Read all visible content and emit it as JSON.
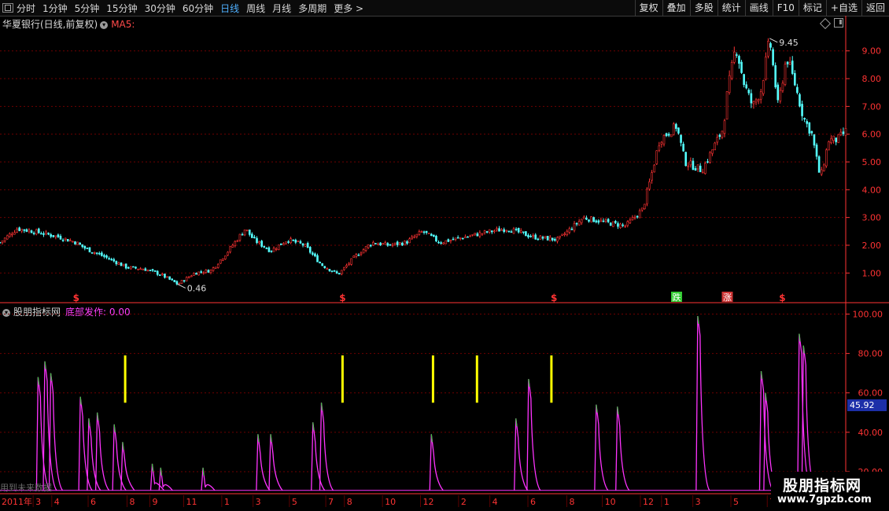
{
  "toolbar": {
    "periods": [
      {
        "label": "分时",
        "active": false
      },
      {
        "label": "1分钟",
        "active": false
      },
      {
        "label": "5分钟",
        "active": false
      },
      {
        "label": "15分钟",
        "active": false
      },
      {
        "label": "30分钟",
        "active": false
      },
      {
        "label": "60分钟",
        "active": false
      },
      {
        "label": "日线",
        "active": true
      },
      {
        "label": "周线",
        "active": false
      },
      {
        "label": "月线",
        "active": false
      },
      {
        "label": "多周期",
        "active": false
      },
      {
        "label": "更多",
        "active": false
      }
    ],
    "more_arrow": ">",
    "right_buttons": [
      "复权",
      "叠加",
      "多股",
      "统计",
      "画线",
      "F10",
      "标记",
      "+自选",
      "返回"
    ]
  },
  "main_panel": {
    "title": "华夏银行(日线,前复权)",
    "ma_label": "MA5:"
  },
  "indicator_panel": {
    "name": "股朋指标网",
    "line_label": "底部发作: 0.00",
    "current_value": "45.92"
  },
  "watermark": "用到未来数据",
  "badge": {
    "title": "股朋指标网",
    "url": "www.7gpzb.com"
  },
  "colors": {
    "up": "#ff3333",
    "down": "#54ffff",
    "indicator": "#ff33ff",
    "green": "#33cc33",
    "signal": "#ffff00",
    "grid": "#6e0000",
    "axis": "#ff3333"
  },
  "chart_data": [
    {
      "type": "candlestick",
      "ylim": [
        0.3,
        9.7
      ],
      "y_ticks": [
        "1.00",
        "2.00",
        "3.00",
        "4.00",
        "5.00",
        "6.00",
        "7.00",
        "8.00",
        "9.00"
      ],
      "y_tick_values": [
        1,
        2,
        3,
        4,
        5,
        6,
        7,
        8,
        9
      ],
      "annotations": [
        {
          "text": "9.45",
          "kind": "high"
        },
        {
          "text": "0.46",
          "kind": "low"
        }
      ],
      "close_path": [
        [
          0,
          2.1
        ],
        [
          0.02,
          2.6
        ],
        [
          0.04,
          2.5
        ],
        [
          0.07,
          2.3
        ],
        [
          0.09,
          2.1
        ],
        [
          0.1,
          1.9
        ],
        [
          0.13,
          1.5
        ],
        [
          0.15,
          1.2
        ],
        [
          0.17,
          1.15
        ],
        [
          0.19,
          0.95
        ],
        [
          0.21,
          0.6
        ],
        [
          0.23,
          1.0
        ],
        [
          0.25,
          1.1
        ],
        [
          0.27,
          1.8
        ],
        [
          0.29,
          2.6
        ],
        [
          0.3,
          2.2
        ],
        [
          0.32,
          1.8
        ],
        [
          0.34,
          2.2
        ],
        [
          0.36,
          2.0
        ],
        [
          0.38,
          1.3
        ],
        [
          0.4,
          0.95
        ],
        [
          0.42,
          1.6
        ],
        [
          0.44,
          2.1
        ],
        [
          0.46,
          2.0
        ],
        [
          0.48,
          2.1
        ],
        [
          0.5,
          2.5
        ],
        [
          0.52,
          2.1
        ],
        [
          0.55,
          2.3
        ],
        [
          0.58,
          2.5
        ],
        [
          0.6,
          2.6
        ],
        [
          0.63,
          2.3
        ],
        [
          0.66,
          2.2
        ],
        [
          0.69,
          3.0
        ],
        [
          0.72,
          2.8
        ],
        [
          0.74,
          2.7
        ],
        [
          0.76,
          3.3
        ],
        [
          0.77,
          4.5
        ],
        [
          0.78,
          5.8
        ],
        [
          0.8,
          6.3
        ],
        [
          0.81,
          5.0
        ],
        [
          0.83,
          4.7
        ],
        [
          0.845,
          5.6
        ],
        [
          0.855,
          6.2
        ],
        [
          0.86,
          7.5
        ],
        [
          0.87,
          9.2
        ],
        [
          0.88,
          7.8
        ],
        [
          0.89,
          7.0
        ],
        [
          0.9,
          7.6
        ],
        [
          0.91,
          9.45
        ],
        [
          0.92,
          7.0
        ],
        [
          0.93,
          8.8
        ],
        [
          0.94,
          7.8
        ],
        [
          0.95,
          6.6
        ],
        [
          0.96,
          6.0
        ],
        [
          0.97,
          4.4
        ],
        [
          0.98,
          5.8
        ],
        [
          0.99,
          5.8
        ],
        [
          1.0,
          6.1
        ]
      ],
      "signals": [
        {
          "pos": 0.09,
          "label": "$",
          "color": "#ff3333"
        },
        {
          "pos": 0.405,
          "label": "$",
          "color": "#ff3333"
        },
        {
          "pos": 0.655,
          "label": "$",
          "color": "#ff3333"
        },
        {
          "pos": 0.8,
          "label": "跌",
          "color": "#33cc33"
        },
        {
          "pos": 0.86,
          "label": "涨",
          "color": "#cc3333"
        },
        {
          "pos": 0.925,
          "label": "$",
          "color": "#ff3333"
        }
      ]
    },
    {
      "type": "line",
      "series": [
        {
          "name": "底部发作",
          "values": [
            0.0
          ]
        }
      ],
      "ylim": [
        10,
        103
      ],
      "y_ticks": [
        "20.00",
        "40.00",
        "60.00",
        "80.00",
        "100.00"
      ],
      "y_tick_values": [
        20,
        40,
        60,
        80,
        100
      ],
      "spikes": [
        {
          "pos": 0.045,
          "h": 68
        },
        {
          "pos": 0.053,
          "h": 76
        },
        {
          "pos": 0.06,
          "h": 70
        },
        {
          "pos": 0.095,
          "h": 58
        },
        {
          "pos": 0.105,
          "h": 47
        },
        {
          "pos": 0.115,
          "h": 50
        },
        {
          "pos": 0.135,
          "h": 44
        },
        {
          "pos": 0.145,
          "h": 35
        },
        {
          "pos": 0.18,
          "h": 24
        },
        {
          "pos": 0.19,
          "h": 22
        },
        {
          "pos": 0.24,
          "h": 22
        },
        {
          "pos": 0.305,
          "h": 39
        },
        {
          "pos": 0.32,
          "h": 39
        },
        {
          "pos": 0.37,
          "h": 45
        },
        {
          "pos": 0.38,
          "h": 55
        },
        {
          "pos": 0.51,
          "h": 39
        },
        {
          "pos": 0.61,
          "h": 47
        },
        {
          "pos": 0.625,
          "h": 67
        },
        {
          "pos": 0.705,
          "h": 54
        },
        {
          "pos": 0.73,
          "h": 53
        },
        {
          "pos": 0.825,
          "h": 99
        },
        {
          "pos": 0.9,
          "h": 71
        },
        {
          "pos": 0.905,
          "h": 60
        },
        {
          "pos": 0.945,
          "h": 90
        },
        {
          "pos": 0.95,
          "h": 84
        }
      ],
      "signal_bars": [
        0.148,
        0.405,
        0.512,
        0.564,
        0.652
      ]
    }
  ],
  "x_axis": {
    "ticks": [
      {
        "label": "2011年",
        "pos": 0.0
      },
      {
        "label": "3",
        "pos": 0.042
      },
      {
        "label": "4",
        "pos": 0.064
      },
      {
        "label": "6",
        "pos": 0.107
      },
      {
        "label": "8",
        "pos": 0.153
      },
      {
        "label": "9",
        "pos": 0.18
      },
      {
        "label": "11",
        "pos": 0.22
      },
      {
        "label": "1",
        "pos": 0.265
      },
      {
        "label": "3",
        "pos": 0.302
      },
      {
        "label": "5",
        "pos": 0.345
      },
      {
        "label": "7",
        "pos": 0.388
      },
      {
        "label": "8",
        "pos": 0.41
      },
      {
        "label": "10",
        "pos": 0.455
      },
      {
        "label": "12",
        "pos": 0.5
      },
      {
        "label": "2",
        "pos": 0.545
      },
      {
        "label": "4",
        "pos": 0.582
      },
      {
        "label": "6",
        "pos": 0.627
      },
      {
        "label": "8",
        "pos": 0.673
      },
      {
        "label": "10",
        "pos": 0.715
      },
      {
        "label": "12",
        "pos": 0.76
      },
      {
        "label": "1",
        "pos": 0.785
      },
      {
        "label": "3",
        "pos": 0.822
      },
      {
        "label": "5",
        "pos": 0.867
      },
      {
        "label": "7",
        "pos": 0.91
      }
    ]
  }
}
